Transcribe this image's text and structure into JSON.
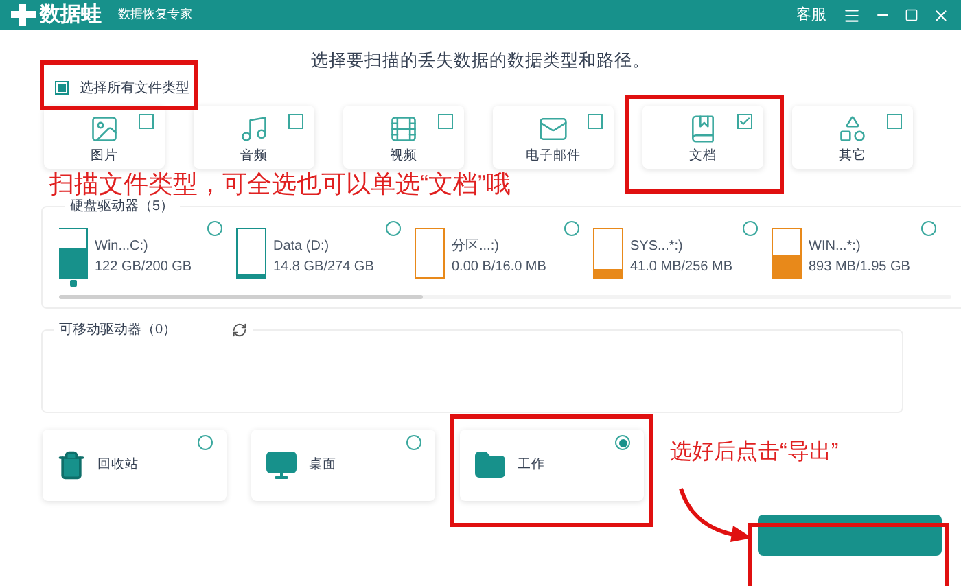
{
  "window": {
    "app_name": "数据蛙",
    "subtitle": "数据恢复专家",
    "support": "客服"
  },
  "heading": "选择要扫描的丢失数据的数据类型和路径。",
  "select_all": {
    "label": "选择所有文件类型",
    "checked": true
  },
  "file_types": [
    {
      "label": "图片",
      "kind": "image",
      "checked": false
    },
    {
      "label": "音频",
      "kind": "audio",
      "checked": false
    },
    {
      "label": "视频",
      "kind": "video",
      "checked": false
    },
    {
      "label": "电子邮件",
      "kind": "email",
      "checked": false
    },
    {
      "label": "文档",
      "kind": "document",
      "checked": true
    },
    {
      "label": "其它",
      "kind": "other",
      "checked": false
    }
  ],
  "hard_drives": {
    "title": "硬盘驱动器（5）",
    "drives": [
      {
        "name": "Win...C:)",
        "usage": "122 GB/200 GB",
        "level": 0.61,
        "color": "#17918b",
        "os_logo": true,
        "selected": false
      },
      {
        "name": "Data (D:)",
        "usage": "14.8 GB/274 GB",
        "level": 0.06,
        "color": "#17918b",
        "os_logo": false,
        "selected": false
      },
      {
        "name": "分区...:)",
        "usage": "0.00  B/16.0 MB",
        "level": 0,
        "color": "#e8891a",
        "os_logo": false,
        "selected": false
      },
      {
        "name": "SYS...*:)",
        "usage": "41.0 MB/256 MB",
        "level": 0.17,
        "color": "#e8891a",
        "os_logo": false,
        "selected": false
      },
      {
        "name": "WIN...*:)",
        "usage": "893 MB/1.95 GB",
        "level": 0.45,
        "color": "#e8891a",
        "os_logo": false,
        "selected": false
      }
    ]
  },
  "removable_drives": {
    "title": "可移动驱动器（0）"
  },
  "locations": [
    {
      "label": "回收站",
      "kind": "trash",
      "selected": false
    },
    {
      "label": "桌面",
      "kind": "desktop",
      "selected": false
    },
    {
      "label": "工作",
      "kind": "folder",
      "selected": true
    }
  ],
  "annotations": {
    "note_1": "扫描文件类型，可全选也可以单选“文档”哦",
    "note_2": "选好后点击“导出”"
  }
}
